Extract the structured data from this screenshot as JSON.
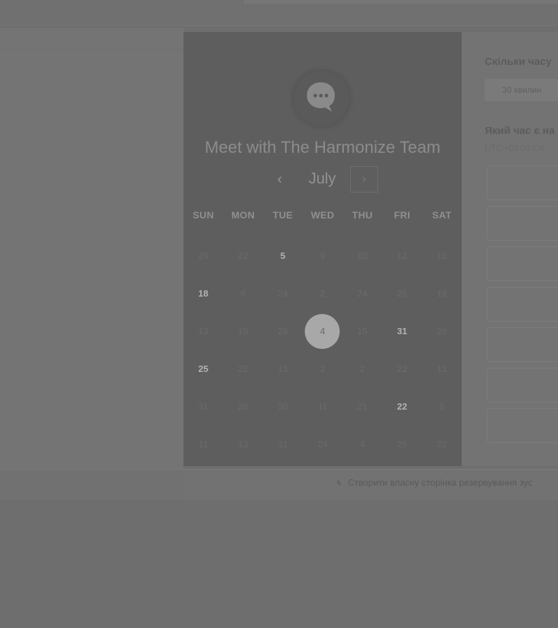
{
  "modal": {
    "title": "Meet with The Harmonize Team",
    "month": "July",
    "prev_glyph": "‹",
    "next_glyph": "›"
  },
  "calendar": {
    "weekdays": [
      "SUN",
      "MON",
      "TUE",
      "WED",
      "THU",
      "FRI",
      "SAT"
    ],
    "rows": [
      [
        "29",
        "22",
        "5",
        "9",
        "10",
        "12",
        "16"
      ],
      [
        "18",
        "6",
        "24",
        "2",
        "24",
        "26",
        "19"
      ],
      [
        "13",
        "19",
        "26",
        "4",
        "15",
        "31",
        "28"
      ],
      [
        "25",
        "22",
        "13",
        "2",
        "2",
        "22",
        "13"
      ],
      [
        "31",
        "28",
        "30",
        "11",
        "21",
        "22",
        "9"
      ],
      [
        "11",
        "13",
        "31",
        "24",
        "4",
        "25",
        "22"
      ]
    ],
    "available": [
      [
        0,
        2
      ],
      [
        1,
        0
      ],
      [
        2,
        5
      ],
      [
        3,
        0
      ],
      [
        4,
        5
      ]
    ],
    "selected": [
      2,
      3
    ]
  },
  "right_panel": {
    "duration_question": "Скільки часу",
    "duration_option": "30 хвилин",
    "time_question": "Який час є на",
    "timezone": "UTC +03:00 Схі",
    "slot_count": 7
  },
  "footer": {
    "link_icon": "hubspot-sprocket-icon",
    "link_text": "Створити власну сторінка резервування зус"
  }
}
